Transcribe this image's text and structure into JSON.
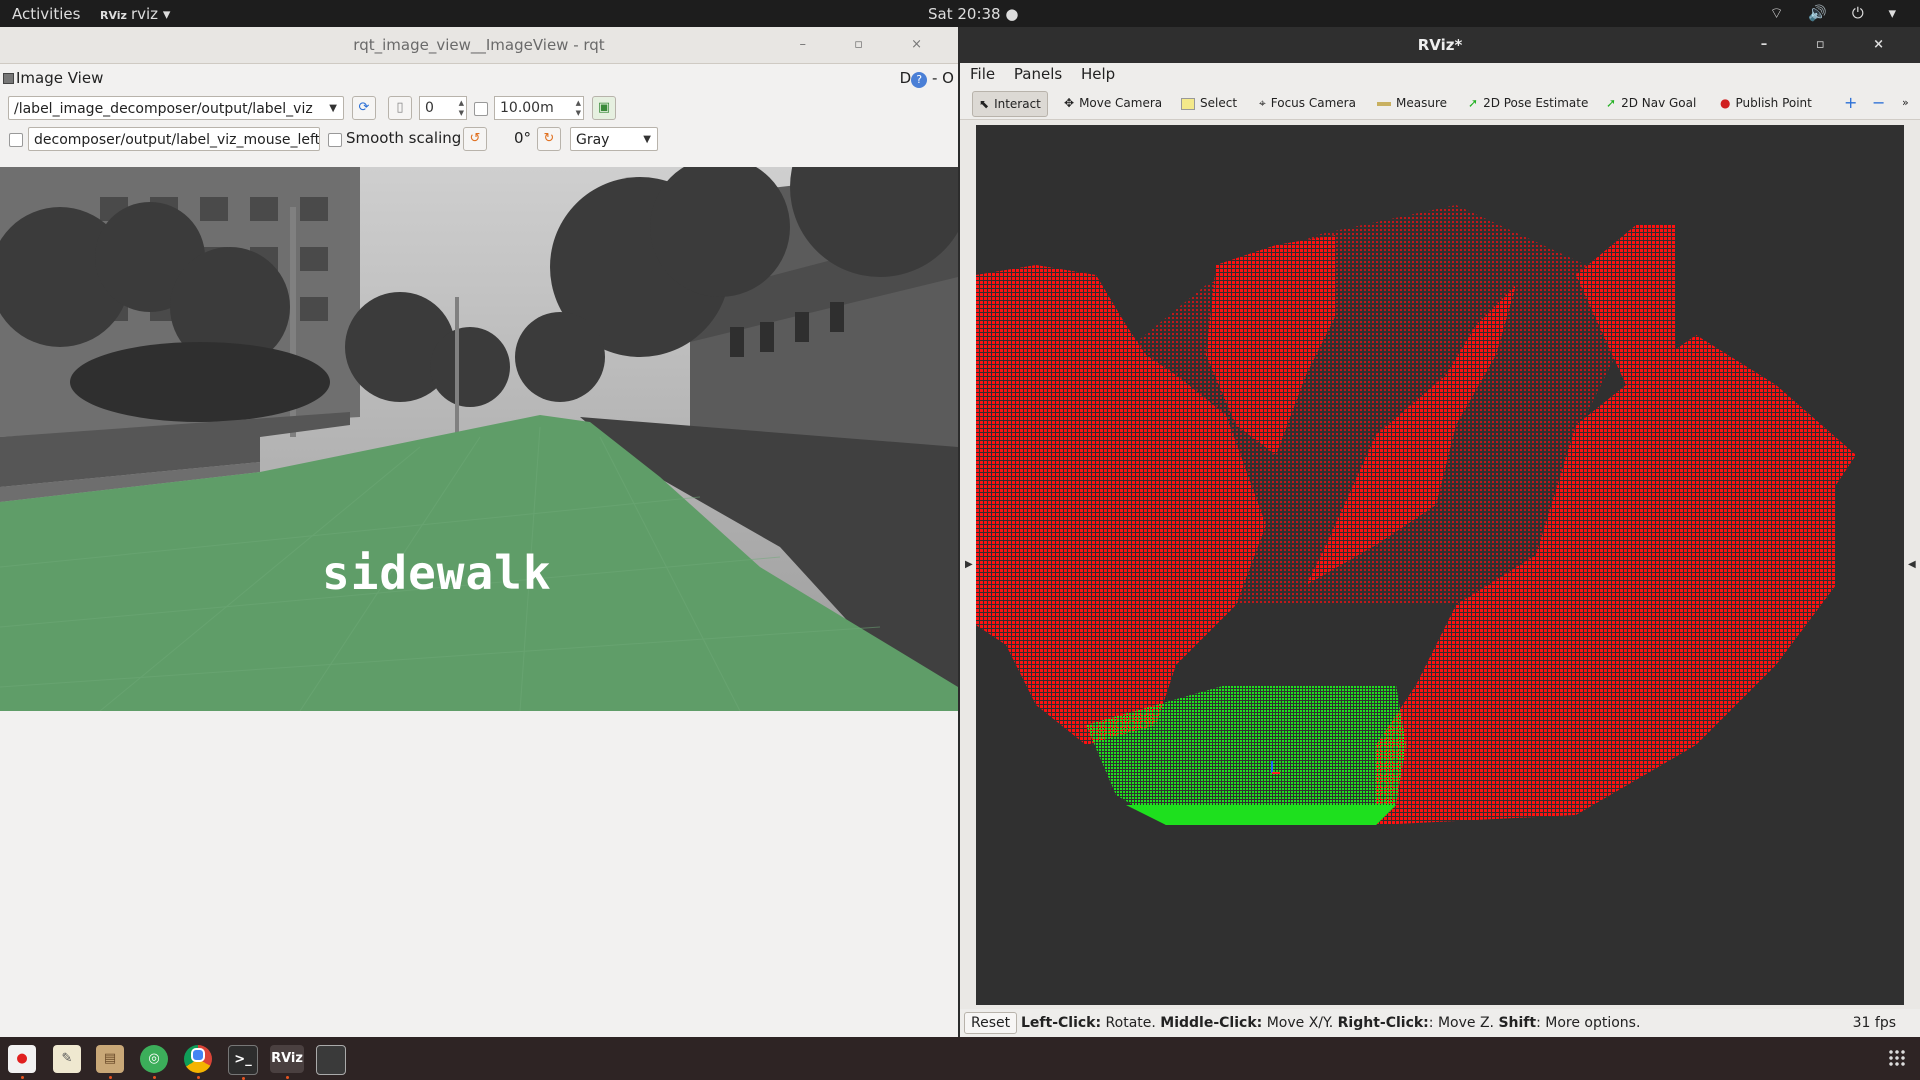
{
  "topbar": {
    "activities": "Activities",
    "app_badge": "RViz",
    "app_name": "rviz ▾",
    "clock": "Sat 20:38 ●",
    "tray": "⌔ 🔊 ⏻ ▾"
  },
  "left_window": {
    "title": "rqt_image_view__ImageView - rqt",
    "controls": "– ▫ ×",
    "dock_title": "Image View",
    "dock_controls_d": "D",
    "dock_controls_help": "?",
    "dock_controls_rest": "- O",
    "topic_combo": "/label_image_decomposer/output/label_viz",
    "spin_value": "0",
    "distance_value": "10.00m",
    "mouse_topic": "decomposer/output/label_viz_mouse_left",
    "smooth_scaling_label": "Smooth scaling",
    "rotation_value": "0°",
    "color_mode": "Gray",
    "overlay_label": "sidewalk"
  },
  "right_window": {
    "title": "RViz*",
    "controls": "– ▫ ×",
    "menu": {
      "file": "File",
      "panels": "Panels",
      "help": "Help"
    },
    "tools": {
      "interact": "Interact",
      "move_camera": "Move Camera",
      "select": "Select",
      "focus_camera": "Focus Camera",
      "measure": "Measure",
      "pose_estimate": "2D Pose Estimate",
      "nav_goal": "2D Nav Goal",
      "publish_point": "Publish Point"
    },
    "status": {
      "reset": "Reset",
      "lc_bold": "Left-Click:",
      "lc_text": " Rotate. ",
      "mc_bold": "Middle-Click:",
      "mc_text": " Move X/Y. ",
      "rc_bold": "Right-Click:",
      "rc_text": ": Move Z. ",
      "sh_bold": "Shift",
      "sh_text": ": More options.",
      "fps": "31 fps"
    }
  },
  "colors": {
    "sidewalk_green": "#5f9d68",
    "obstacle_red": "#ff1010",
    "ground_green": "#1ee01e",
    "rviz_bg": "#303030",
    "ubuntu_orange": "#e95420"
  },
  "taskbar": {
    "apps": [
      "record-icon",
      "text-editor-icon",
      "files-icon",
      "network-icon",
      "chrome-icon",
      "terminal-icon",
      "rviz-icon",
      "window-icon"
    ],
    "rviz_label": "RViz"
  }
}
